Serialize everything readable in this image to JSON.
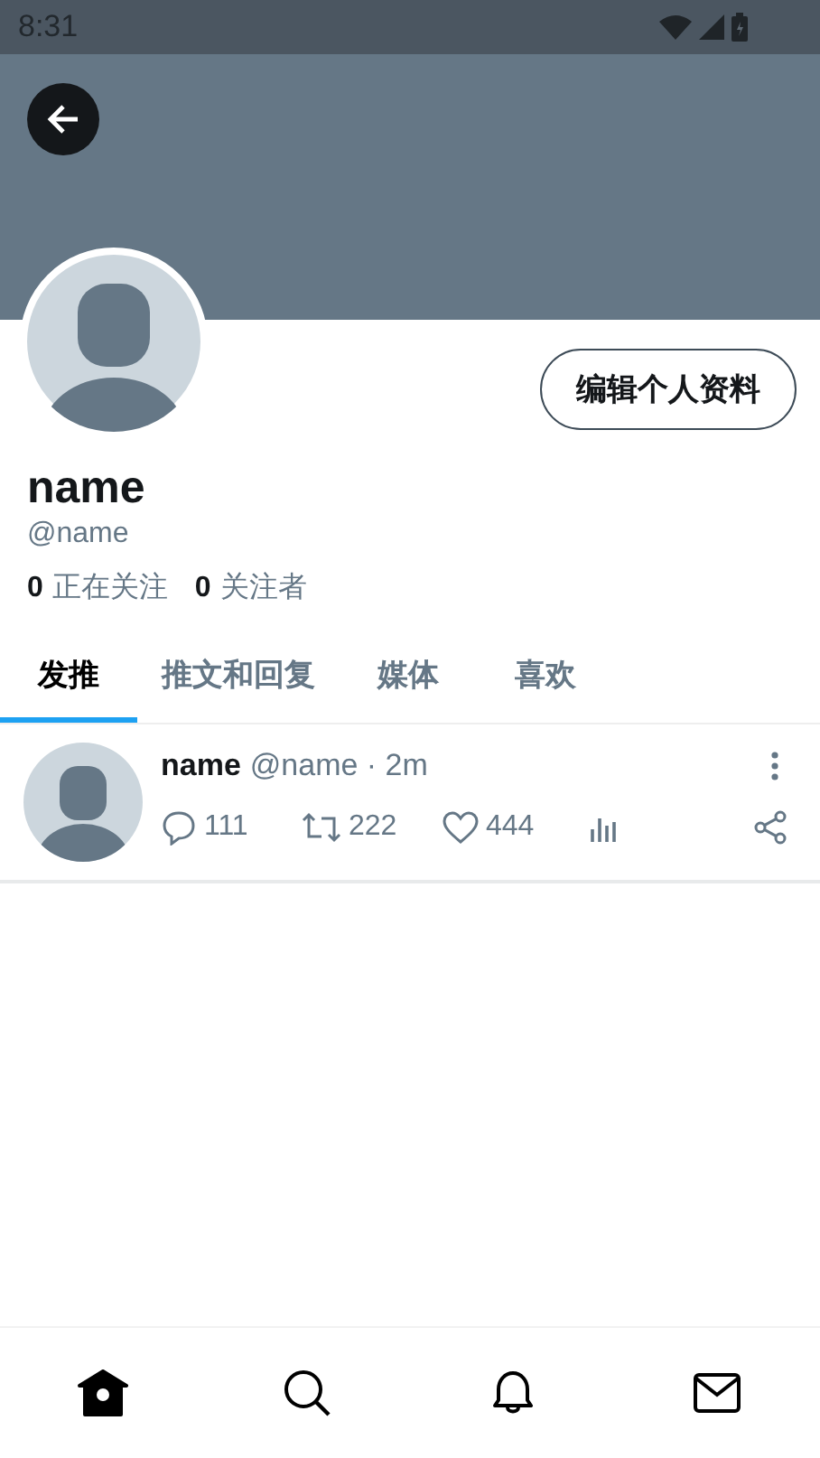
{
  "status_bar": {
    "time": "8:31"
  },
  "profile": {
    "name": "name",
    "handle": "@name",
    "edit_button": "编辑个人资料",
    "following_count": "0",
    "following_label": "正在关注",
    "followers_count": "0",
    "followers_label": "关注者"
  },
  "tabs": [
    {
      "label": "发推",
      "selected": true
    },
    {
      "label": "推文和回复",
      "selected": false
    },
    {
      "label": "媒体",
      "selected": false
    },
    {
      "label": "喜欢",
      "selected": false
    }
  ],
  "tweets": [
    {
      "name": "name",
      "meta": "@name · 2m",
      "replies": "111",
      "retweets": "222",
      "likes": "444"
    }
  ],
  "bottom_nav": [
    {
      "kind": "home",
      "selected": true
    },
    {
      "kind": "search",
      "selected": false
    },
    {
      "kind": "notifications",
      "selected": false
    },
    {
      "kind": "messages",
      "selected": false
    }
  ]
}
